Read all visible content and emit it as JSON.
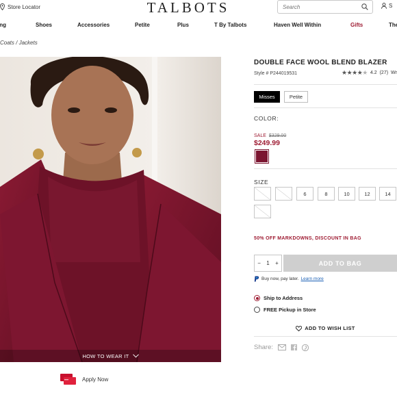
{
  "header": {
    "store_locator": "Store Locator",
    "logo": "TALBOTS",
    "search_placeholder": "Search",
    "signin": "S"
  },
  "nav": [
    {
      "label": "ing"
    },
    {
      "label": "Shoes"
    },
    {
      "label": "Accessories"
    },
    {
      "label": "Petite"
    },
    {
      "label": "Plus"
    },
    {
      "label": "T By Talbots"
    },
    {
      "label": "Haven Well Within"
    },
    {
      "label": "Gifts"
    },
    {
      "label": "The"
    }
  ],
  "breadcrumb": "Coats / Jackets",
  "hero": {
    "how_to_wear": "HOW TO WEAR IT"
  },
  "promo": {
    "apply_now": "Apply Now"
  },
  "product": {
    "title": "DOUBLE FACE WOOL BLEND BLAZER",
    "style": "Style # P244019531",
    "rating_value": "4.2",
    "rating_count": "(27)",
    "rating_stars": 4.2,
    "rating_extra": "Wr",
    "fits": [
      "Misses",
      "Petite"
    ],
    "selected_fit": "Misses",
    "color_label": "COLOR:",
    "sale_label": "SALE",
    "original_price": "$329.00",
    "sale_price": "$249.99",
    "swatch_color": "#7b1530",
    "size_label": "SIZE",
    "sizes_row1": [
      {
        "label": "",
        "available": false
      },
      {
        "label": "",
        "available": false
      },
      {
        "label": "6",
        "available": true
      },
      {
        "label": "8",
        "available": true
      },
      {
        "label": "10",
        "available": true
      },
      {
        "label": "12",
        "available": true
      },
      {
        "label": "14",
        "available": true
      }
    ],
    "sizes_row2": [
      {
        "label": "",
        "available": false
      }
    ],
    "markdown_message": "50% OFF MARKDOWNS, DISCOUNT IN BAG",
    "quantity": "1",
    "add_to_bag": "ADD TO BAG",
    "paypal_text": "Buy now, pay later.",
    "learn_more": "Learn more",
    "ship_to_address": "Ship to Address",
    "free_pickup": "FREE Pickup in Store",
    "add_to_wishlist": "ADD TO WISH LIST",
    "share_label": "Share:"
  },
  "colors": {
    "brand_red": "#9e1b32",
    "garment": "#7b1530",
    "button_disabled": "#cfcfcf"
  }
}
